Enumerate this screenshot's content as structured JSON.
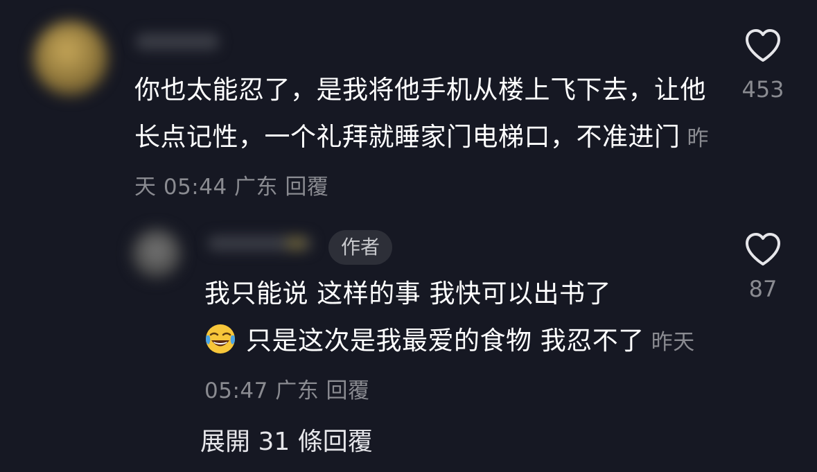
{
  "comments": [
    {
      "text": "你也太能忍了，是我将他手机从楼上飞下去，让他长点记性，一个礼拜就睡家门电梯口，不准进门",
      "meta": "昨天 05:44 广东 回覆",
      "likes": "453"
    },
    {
      "badge": "作者",
      "text_line1": "我只能说 这样的事 我快可以出书了",
      "emoji": "tears-of-joy-emoji",
      "text_line2": "只是这次是我最爱的食物 我忍不了",
      "meta": "昨天 05:47 广东 回覆",
      "likes": "87"
    }
  ],
  "expand_replies": "展開 31 條回覆",
  "colors": {
    "background": "#161823",
    "text": "#ffffff",
    "meta": "#8a8b91",
    "badge_bg": "#2d2f38"
  },
  "icons": [
    "heart-icon",
    "tears-of-joy-emoji"
  ]
}
